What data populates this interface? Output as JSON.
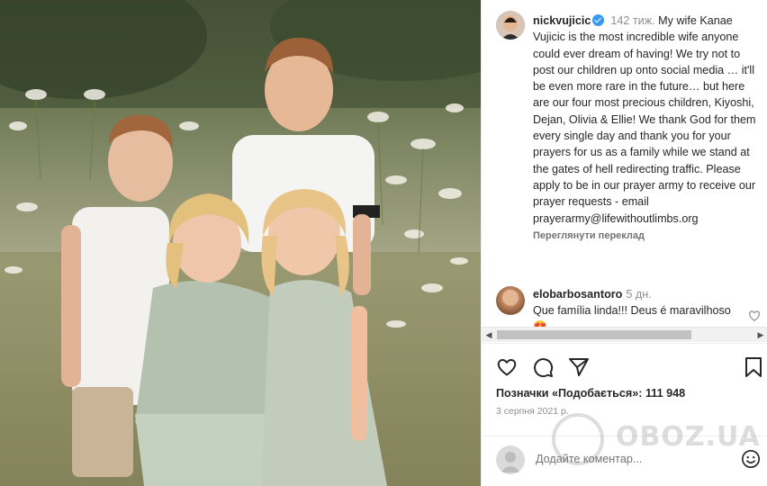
{
  "post": {
    "username": "nickvujicic",
    "age": "142 тиж.",
    "caption": "My wife Kanae Vujicic is the most incredible wife anyone could ever dream of having! We try not to post our children up onto social media … it'll be even more rare in the future… but here are our four most precious children, Kiyoshi, Dejan, Olivia & Ellie! We thank God for them every single day and thank you for your prayers for us as a family while we stand at the gates of hell redirecting traffic. Please apply to be in our prayer army to receive our prayer requests - email prayerarmy@lifewithoutlimbs.org",
    "translate_label": "Переглянути переклад"
  },
  "comment": {
    "username": "elobarbosantoro",
    "age": "5 дн.",
    "text": "Que família linda!!! Deus é maravilhoso 😍"
  },
  "likes": "Позначки «Подобається»: 111 948",
  "date": "3 серпня 2021 р.",
  "comment_input": {
    "placeholder": "Додайте коментар..."
  },
  "watermark": "OBOZ.UA",
  "icons": {
    "verified": "verified-badge-icon",
    "like": "heart-icon",
    "comment": "comment-bubble-icon",
    "share": "paper-plane-icon",
    "save": "bookmark-icon",
    "emoji": "smiley-icon"
  },
  "colors": {
    "verified": "#3897f0",
    "text": "#262626",
    "muted": "#8e8e8e"
  }
}
